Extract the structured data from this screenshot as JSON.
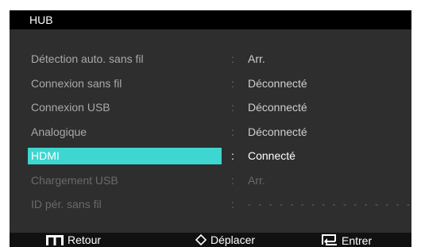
{
  "header": {
    "title": "HUB"
  },
  "menu": {
    "items": [
      {
        "label": "Détection auto. sans fil",
        "separator": ":",
        "value": "Arr."
      },
      {
        "label": "Connexion sans fil",
        "separator": ":",
        "value": "Déconnecté"
      },
      {
        "label": "Connexion USB",
        "separator": ":",
        "value": "Déconnecté"
      },
      {
        "label": "Analogique",
        "separator": ":",
        "value": "Déconnecté"
      },
      {
        "label": "HDMI",
        "separator": ":",
        "value": "Connecté",
        "selected": true
      },
      {
        "label": "Chargement USB",
        "separator": ":",
        "value": "Arr."
      },
      {
        "label": "ID pér. sans fil",
        "separator": ":",
        "value": "- - - - - - - - - - - - - - - -"
      }
    ]
  },
  "footer": {
    "back_icon": "menu-grid-icon",
    "back_label": "Retour",
    "move_icon": "diamond-arrows-icon",
    "move_label": "Déplacer",
    "enter_icon": "enter-icon",
    "enter_label": "Entrer"
  },
  "colors": {
    "panel": "#2e2e2e",
    "titlebar": "#000000",
    "footer": "#111111",
    "highlight": "#3dd6d0",
    "text": "#a9a9a9"
  }
}
